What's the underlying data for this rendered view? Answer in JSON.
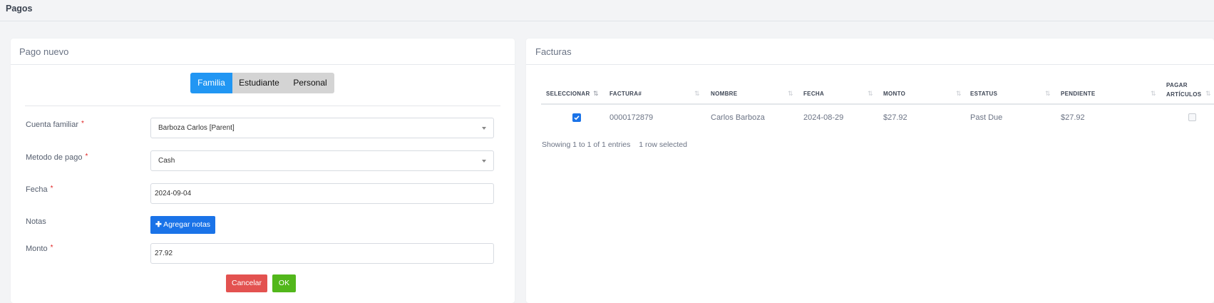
{
  "page": {
    "title": "Pagos"
  },
  "new_payment": {
    "title": "Pago nuevo",
    "tabs": [
      {
        "label": "Familia",
        "active": true
      },
      {
        "label": "Estudiante",
        "active": false
      },
      {
        "label": "Personal",
        "active": false
      }
    ],
    "fields": {
      "family_account": {
        "label": "Cuenta familiar",
        "value": "Barboza Carlos [Parent]"
      },
      "payment_method": {
        "label": "Metodo de pago",
        "value": "Cash"
      },
      "date": {
        "label": "Fecha",
        "value": "2024-09-04"
      },
      "notes": {
        "label": "Notas",
        "button_label": "Agregar notas"
      },
      "amount": {
        "label": "Monto",
        "value": "27.92"
      }
    },
    "required_mark": "*",
    "cancel_label": "Cancelar",
    "ok_label": "OK"
  },
  "invoices": {
    "title": "Facturas",
    "columns": [
      "SELECCIONAR",
      "FACTURA#",
      "NOMBRE",
      "FECHA",
      "MONTO",
      "ESTATUS",
      "PENDIENTE",
      "PAGAR",
      "ARTÍCULOS"
    ],
    "rows": [
      {
        "selected": true,
        "invoice": "0000172879",
        "name": "Carlos Barboza",
        "date": "2024-08-29",
        "amount": "$27.92",
        "status": "Past Due",
        "pending": "$27.92",
        "pay_items": false
      }
    ],
    "info_text": "Showing 1 to 1 of 1 entries",
    "selected_text": "1 row selected"
  },
  "colors": {
    "primary": "#2196f3",
    "button_blue": "#1a73e8",
    "cancel": "#e35250",
    "ok": "#52b71b",
    "required": "#e02424"
  }
}
